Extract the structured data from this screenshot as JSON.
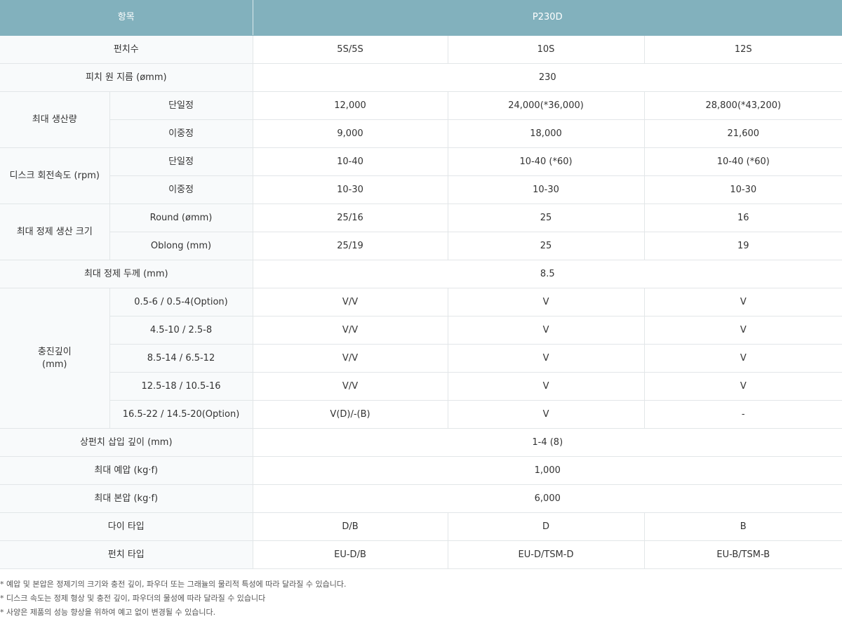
{
  "header": {
    "item": "항목",
    "model": "P230D"
  },
  "punch_count": {
    "label": "펀치수",
    "values": [
      "5S/5S",
      "10S",
      "12S"
    ]
  },
  "pitch_diameter": {
    "label": "피치 원 지름 (ømm)",
    "value": "230"
  },
  "max_output": {
    "label": "최대 생산량",
    "single": {
      "label": "단일정",
      "values": [
        "12,000",
        "24,000(*36,000)",
        "28,800(*43,200)"
      ]
    },
    "double": {
      "label": "이중정",
      "values": [
        "9,000",
        "18,000",
        "21,600"
      ]
    }
  },
  "disc_speed": {
    "label": "디스크 회전속도 (rpm)",
    "single": {
      "label": "단일정",
      "values": [
        "10-40",
        "10-40 (*60)",
        "10-40 (*60)"
      ]
    },
    "double": {
      "label": "이중정",
      "values": [
        "10-30",
        "10-30",
        "10-30"
      ]
    }
  },
  "max_tablet_size": {
    "label": "최대 정제 생산 크기",
    "round": {
      "label": "Round (ømm)",
      "values": [
        "25/16",
        "25",
        "16"
      ]
    },
    "oblong": {
      "label": "Oblong (mm)",
      "values": [
        "25/19",
        "25",
        "19"
      ]
    }
  },
  "max_thickness": {
    "label": "최대 정제 두께 (mm)",
    "value": "8.5"
  },
  "fill_depth": {
    "label_line1": "충진깊이",
    "label_line2": "(mm)",
    "rows": [
      {
        "label": "0.5-6 / 0.5-4(Option)",
        "values": [
          "V/V",
          "V",
          "V"
        ]
      },
      {
        "label": "4.5-10 / 2.5-8",
        "values": [
          "V/V",
          "V",
          "V"
        ]
      },
      {
        "label": "8.5-14 / 6.5-12",
        "values": [
          "V/V",
          "V",
          "V"
        ]
      },
      {
        "label": "12.5-18 / 10.5-16",
        "values": [
          "V/V",
          "V",
          "V"
        ]
      },
      {
        "label": "16.5-22 / 14.5-20(Option)",
        "values": [
          "V(D)/-(B)",
          "V",
          "-"
        ]
      }
    ]
  },
  "upper_punch_depth": {
    "label": "상펀치 삽입 깊이 (mm)",
    "value": "1-4 (8)"
  },
  "max_precompression": {
    "label": "최대 예압 (kg·f)",
    "value": "1,000"
  },
  "max_main_compression": {
    "label": "최대 본압 (kg·f)",
    "value": "6,000"
  },
  "die_type": {
    "label": "다이 타입",
    "values": [
      "D/B",
      "D",
      "B"
    ]
  },
  "punch_type": {
    "label": "펀치 타입",
    "values": [
      "EU-D/B",
      "EU-D/TSM-D",
      "EU-B/TSM-B"
    ]
  },
  "notes": [
    "* 예압 및 본압은 정제기의 크기와 충전 깊이, 파우더 또는 그래뉼의 물리적 특성에 따라 달라질 수 있습니다.",
    "* 디스크 속도는 정제 형상 및 충전 깊이, 파우더의 물성에 따라 달라질 수 있습니다",
    "* 사양은 제품의 성능 향상을 위하여 예고 없이 변경될 수 있습니다."
  ]
}
